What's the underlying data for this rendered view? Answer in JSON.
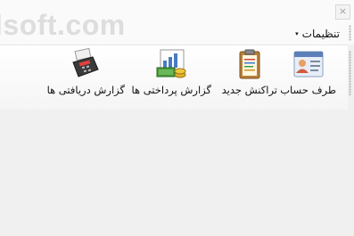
{
  "watermark": "lsoft.com",
  "window": {
    "close_glyph": "×"
  },
  "menu": {
    "settings_label": "تنظیمات",
    "chevron": "▾"
  },
  "toolbar": {
    "buttons": [
      {
        "label": "طرف حساب",
        "icon": "contact-card-icon"
      },
      {
        "label": "تراکنش جدید",
        "icon": "clipboard-icon"
      },
      {
        "label": "گزارش پرداختی ها",
        "icon": "money-chart-icon"
      },
      {
        "label": "گزارش دریافتی ها",
        "icon": "card-reader-icon"
      }
    ]
  }
}
